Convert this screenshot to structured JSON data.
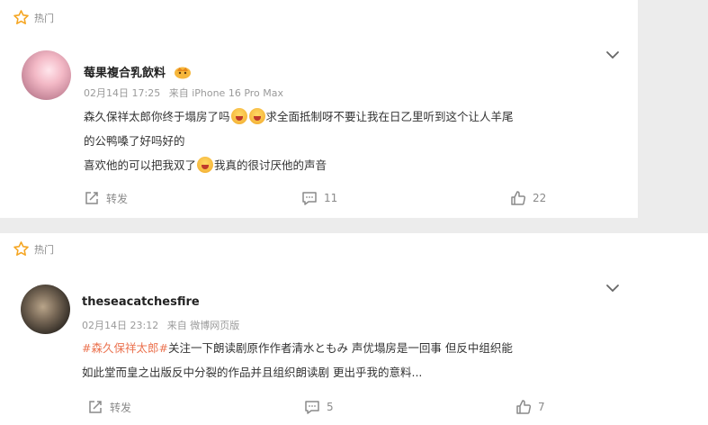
{
  "comments": [
    {
      "hot_label": "热门",
      "username": "莓果複合乳飲料",
      "date": "02月14日 17:25",
      "source": "来自 iPhone 16 Pro Max",
      "line1_a": "森久保祥太郎你终于塌房了吗",
      "line1_b": "求全面抵制呀不要让我在日乙里听到这个让人羊尾",
      "line2": "的公鸭嗓了好吗好的",
      "line3_a": "喜欢他的可以把我双了",
      "line3_b": "我真的很讨厌他的声音",
      "repost_label": "转发",
      "comment_count": "11",
      "like_count": "22"
    },
    {
      "hot_label": "热门",
      "username": "theseacatchesfire",
      "date": "02月14日 23:12",
      "source": "来自 微博网页版",
      "hashtag": "#森久保祥太郎#",
      "line1_rest": "关注一下朗读剧原作作者清水ともみ 声优塌房是一回事 但反中组织能",
      "line2": "如此堂而皇之出版反中分裂的作品并且组织朗读剧 更出乎我的意料...",
      "repost_label": "转发",
      "comment_count": "5",
      "like_count": "7"
    }
  ],
  "colors": {
    "hot_star": "#f5a623",
    "hashtag": "#eb7350",
    "muted": "#9a9a9a"
  },
  "icons": [
    "star-icon",
    "chevron-down-icon",
    "repost-icon",
    "comment-icon",
    "like-icon",
    "crown-badge-icon",
    "laughing-emoji-icon",
    "shouting-emoji-icon"
  ]
}
